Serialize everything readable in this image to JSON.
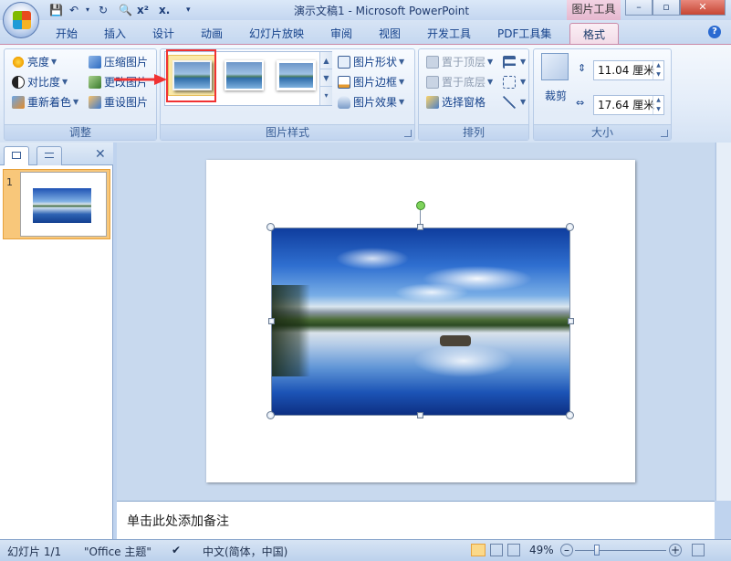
{
  "window": {
    "title": "演示文稿1 - Microsoft PowerPoint",
    "context_tab_header": "图片工具"
  },
  "tabs": [
    "开始",
    "插入",
    "设计",
    "动画",
    "幻灯片放映",
    "审阅",
    "视图",
    "开发工具",
    "PDF工具集",
    "格式"
  ],
  "active_tab": "格式",
  "ribbon": {
    "adjust": {
      "label": "调整",
      "brightness": "亮度",
      "contrast": "对比度",
      "recolor": "重新着色",
      "compress": "压缩图片",
      "change_picture": "更改图片",
      "reset_picture": "重设图片"
    },
    "styles": {
      "label": "图片样式",
      "shape": "图片形状",
      "border": "图片边框",
      "effects": "图片效果"
    },
    "arrange": {
      "label": "排列",
      "bring_front": "置于顶层",
      "send_back": "置于底层",
      "selection_pane": "选择窗格"
    },
    "size": {
      "label": "大小",
      "crop": "裁剪",
      "height": "11.04 厘米",
      "width": "17.64 厘米"
    }
  },
  "slides_pane": {
    "slide_number": "1"
  },
  "notes": {
    "placeholder": "单击此处添加备注"
  },
  "status": {
    "slide_info": "幻灯片 1/1",
    "theme": "\"Office 主题\"",
    "language": "中文(简体，中国)",
    "zoom": "49%"
  },
  "colors": {
    "accent_highlight": "#f03232",
    "context_tab": "#e6b8cf"
  }
}
